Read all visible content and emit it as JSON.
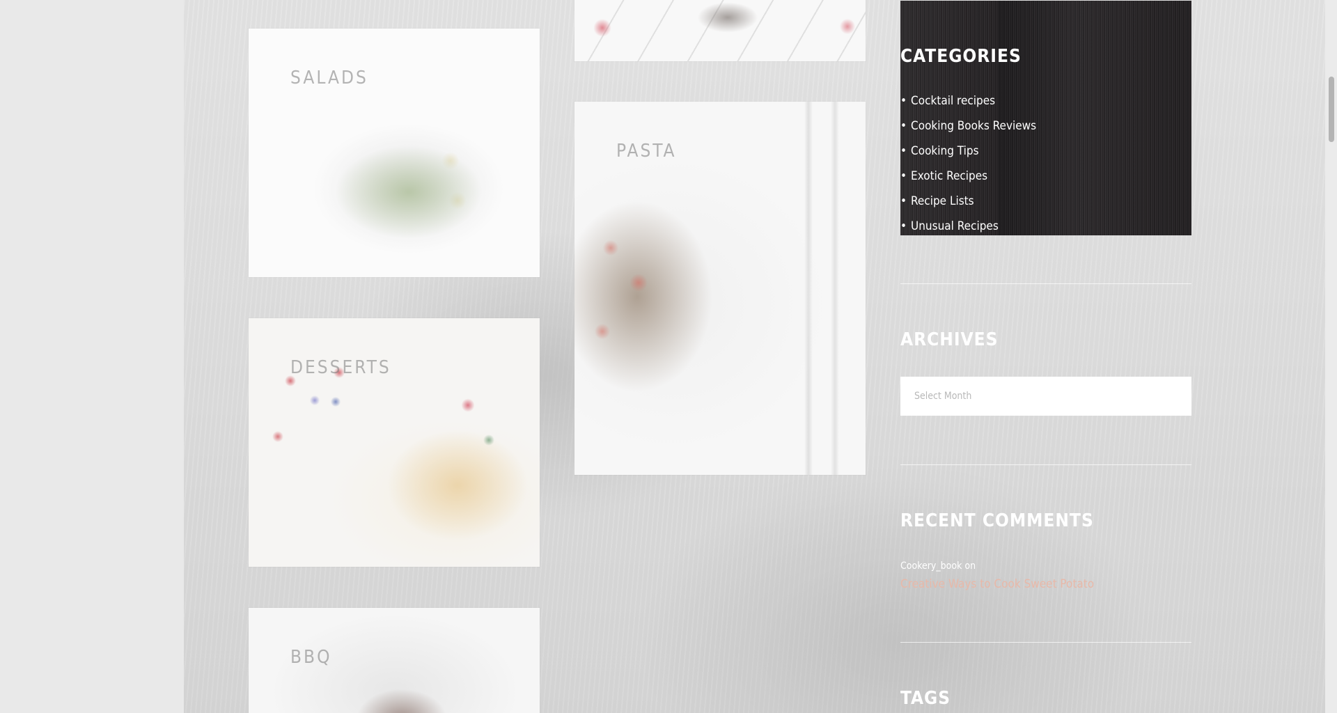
{
  "categories_grid": [
    {
      "label": "SALADS"
    },
    {
      "label": "PASTA"
    },
    {
      "label": "DESSERTS"
    },
    {
      "label": "BBQ"
    }
  ],
  "sidebar": {
    "categories": {
      "title": "CATEGORIES",
      "items": [
        {
          "label": "Cocktail recipes"
        },
        {
          "label": "Cooking Books Reviews"
        },
        {
          "label": "Cooking Tips"
        },
        {
          "label": "Exotic Recipes"
        },
        {
          "label": "Recipe Lists"
        },
        {
          "label": "Unusual Recipes"
        }
      ]
    },
    "archives": {
      "title": "ARCHIVES",
      "select_placeholder": "Select Month"
    },
    "recent_comments": {
      "title": "RECENT COMMENTS",
      "author": "Cookery_book",
      "on": "on",
      "link": "Creative Ways to Cook Sweet Potato"
    },
    "tags": {
      "title": "TAGS"
    }
  },
  "colors": {
    "link": "#e8b8a8",
    "widget_dark": "#272426"
  }
}
